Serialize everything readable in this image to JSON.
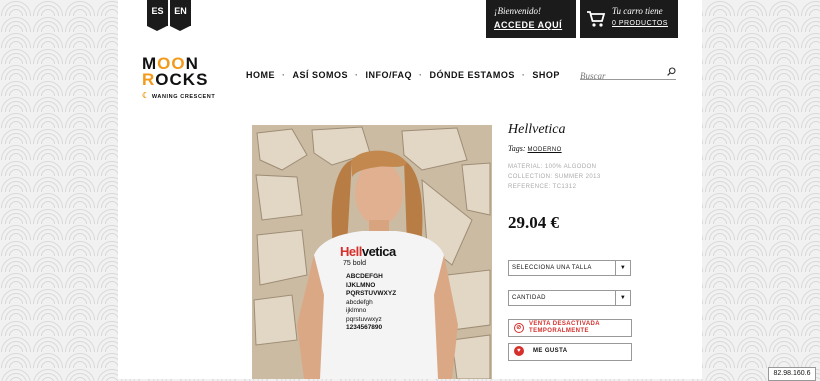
{
  "lang": [
    "ES",
    "EN"
  ],
  "welcome": {
    "greeting": "¡Bienvenido!",
    "link": "ACCEDE AQUÍ"
  },
  "cart": {
    "label": "Tu carro tiene",
    "count": "0 PRODUCTOS",
    "icon": "cart-icon"
  },
  "logo": {
    "line1a": "M",
    "line1b": "OO",
    "line1c": "N",
    "line2a": "R",
    "line2b": "O",
    "line2c": "CKS",
    "tagline": "WANING CRESCENT"
  },
  "nav": [
    "HOME",
    "ASÍ SOMOS",
    "INFO/FAQ",
    "DÓNDE ESTAMOS",
    "SHOP"
  ],
  "search": {
    "placeholder": "Buscar",
    "icon": "search-icon"
  },
  "product": {
    "title": "Hellvetica",
    "tags_label": "Tags:",
    "tag": "MODERNO",
    "material": "MATERIAL: 100% ALGODON",
    "collection": "COLLECTION: SUMMER 2013",
    "reference": "REFERENCE: TC1312",
    "price": "29.04 €",
    "size_select": "SELECCIONA UNA TALLA",
    "qty_select": "CANTIDAD",
    "sale_status": "VENTA DESACTIVADA TEMPORALMENTE",
    "like": "ME GUSTA"
  },
  "shirt": {
    "brand_red": "Hell",
    "brand_black": "vetica",
    "weight": "75 bold",
    "lines": [
      "ABCDEFGH",
      "IJKLMNO",
      "PQRSTUVWXYZ",
      "abcdefgh",
      "ijklmno",
      "pqrstuvwxyz",
      "1234567890"
    ]
  },
  "ip": "82.98.160.6",
  "colors": {
    "accent": "#f39a1b",
    "red": "#d6302c",
    "dark": "#1b1b1b"
  }
}
